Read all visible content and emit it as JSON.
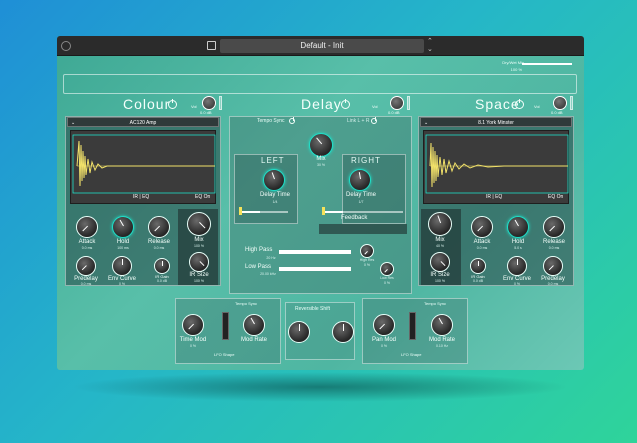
{
  "titlebar": {
    "preset_name": "Default - Init"
  },
  "global": {
    "dry_wet_label": "Dry/Wet Mix",
    "dry_wet_value": "100 %",
    "dry_wet_fraction": 1.0
  },
  "colour": {
    "title": "Colour",
    "vol_label": "Vol",
    "vol_value": "0.0 dB",
    "ir_name": "AC120 Amp",
    "ir_tabs": "IR | EQ",
    "eq_status": "EQ On",
    "knobs": {
      "attack": {
        "label": "Attack",
        "value": "0.0 ms"
      },
      "hold": {
        "label": "Hold",
        "value": "100 ms"
      },
      "release": {
        "label": "Release",
        "value": "0.0 ms"
      },
      "mix": {
        "label": "Mix",
        "value": "100 %"
      },
      "predelay": {
        "label": "Predelay",
        "value": "0.0 ms"
      },
      "env_curve": {
        "label": "Env Curve",
        "value": "0 %"
      },
      "ir_gain": {
        "label": "IR Gain",
        "value": "0.0 dB"
      },
      "ir_size": {
        "label": "IR Size",
        "value": "100 %"
      }
    }
  },
  "delay": {
    "title": "Delay",
    "vol_label": "Vol",
    "vol_value": "0.0 dB",
    "tempo_sync": "Tempo Sync",
    "link": "Link L + R",
    "mix_label": "Mix",
    "mix_value": "30 %",
    "left_label": "LEFT",
    "right_label": "RIGHT",
    "left_delay_label": "Delay Time",
    "left_delay_value": "1/4",
    "right_delay_label": "Delay Time",
    "right_delay_value": "1/7",
    "feedback_label": "Feedback",
    "high_pass_label": "High Pass",
    "high_pass_value": "20 Hz",
    "low_pass_label": "Low Pass",
    "low_pass_value": "20.00 kHz",
    "high_res_label": "High Res",
    "high_res_value": "0 %",
    "low_res_label": "Low Res",
    "low_res_value": "0 %",
    "reverse_label": "Reversible Shift",
    "lfo_left": {
      "tempo_sync": "Tempo Sync",
      "time_mod_label": "Time Mod",
      "time_mod_value": "0 %",
      "rate_label": "Mod Rate",
      "lfo_shape": "LFO Shape"
    },
    "lfo_right": {
      "tempo_sync": "Tempo Sync",
      "pan_mod_label": "Pan Mod",
      "pan_mod_value": "0 %",
      "mod_rate_label": "Mod Rate",
      "mod_rate_value": "0.10 Hz",
      "lfo_shape": "LFO Shape"
    }
  },
  "space": {
    "title": "Space",
    "vol_label": "Vol",
    "vol_value": "0.0 dB",
    "ir_name": "8.1 York Minster",
    "ir_tabs": "IR | EQ",
    "eq_status": "EQ On",
    "knobs": {
      "mix": {
        "label": "Mix",
        "value": "40 %"
      },
      "attack": {
        "label": "Attack",
        "value": "0.0 ms"
      },
      "hold": {
        "label": "Hold",
        "value": "5.0 s"
      },
      "release": {
        "label": "Release",
        "value": "0.0 ms"
      },
      "ir_size": {
        "label": "IR Size",
        "value": "100 %"
      },
      "ir_gain": {
        "label": "IR Gain",
        "value": "0.0 dB"
      },
      "env_curve": {
        "label": "Env Curve",
        "value": "0 %"
      },
      "predelay": {
        "label": "Predelay",
        "value": "0.0 ms"
      }
    }
  },
  "colors": {
    "accent": "#1fe0c9",
    "waveform": "#f2e26a",
    "panel_bg": "#3b3b3b"
  }
}
